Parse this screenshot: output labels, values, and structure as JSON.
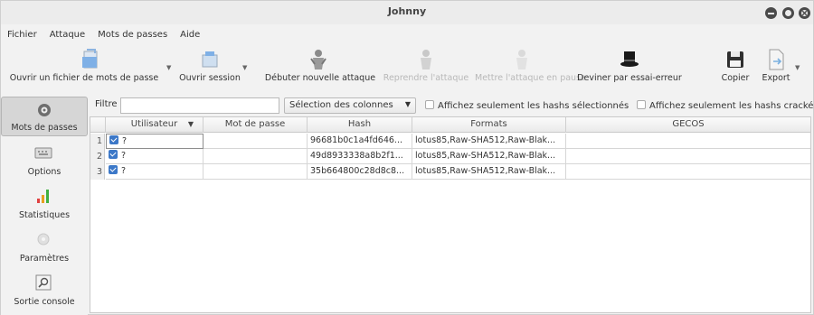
{
  "window": {
    "title": "Johnny"
  },
  "menu": [
    "Fichier",
    "Attaque",
    "Mots de passes",
    "Aide"
  ],
  "toolbar": {
    "open_passwords": "Ouvrir un fichier de mots de passe",
    "open_session": "Ouvrir session",
    "new_attack": "Débuter nouvelle attaque",
    "resume": "Reprendre l'attaque",
    "pause": "Mettre l'attaque en pause",
    "guess": "Deviner par essai-erreur",
    "copy": "Copier",
    "export": "Export"
  },
  "sidebar": [
    "Mots de passes",
    "Options",
    "Statistiques",
    "Paramètres",
    "Sortie console"
  ],
  "filter": {
    "label": "Filtre",
    "value": "",
    "columns_button": "Sélection des colonnes",
    "only_selected": "Affichez seulement les hashs sélectionnés",
    "only_cracked": "Affichez seulement les hashs crackés"
  },
  "table": {
    "headers": [
      "Utilisateur",
      "Mot de passe",
      "Hash",
      "Formats",
      "GECOS"
    ],
    "rows": [
      {
        "n": "1",
        "user": "?",
        "password": "",
        "hash": "96681b0c1a4fd646...",
        "formats": "lotus85,Raw-SHA512,Raw-Blak..."
      },
      {
        "n": "2",
        "user": "?",
        "password": "",
        "hash": "49d8933338a8b2f1...",
        "formats": "lotus85,Raw-SHA512,Raw-Blak..."
      },
      {
        "n": "3",
        "user": "?",
        "password": "",
        "hash": "35b664800c28d8c8...",
        "formats": "lotus85,Raw-SHA512,Raw-Blak..."
      }
    ]
  },
  "colors": {
    "accent": "#3c78c8",
    "window_bg": "#f2f2f2"
  }
}
